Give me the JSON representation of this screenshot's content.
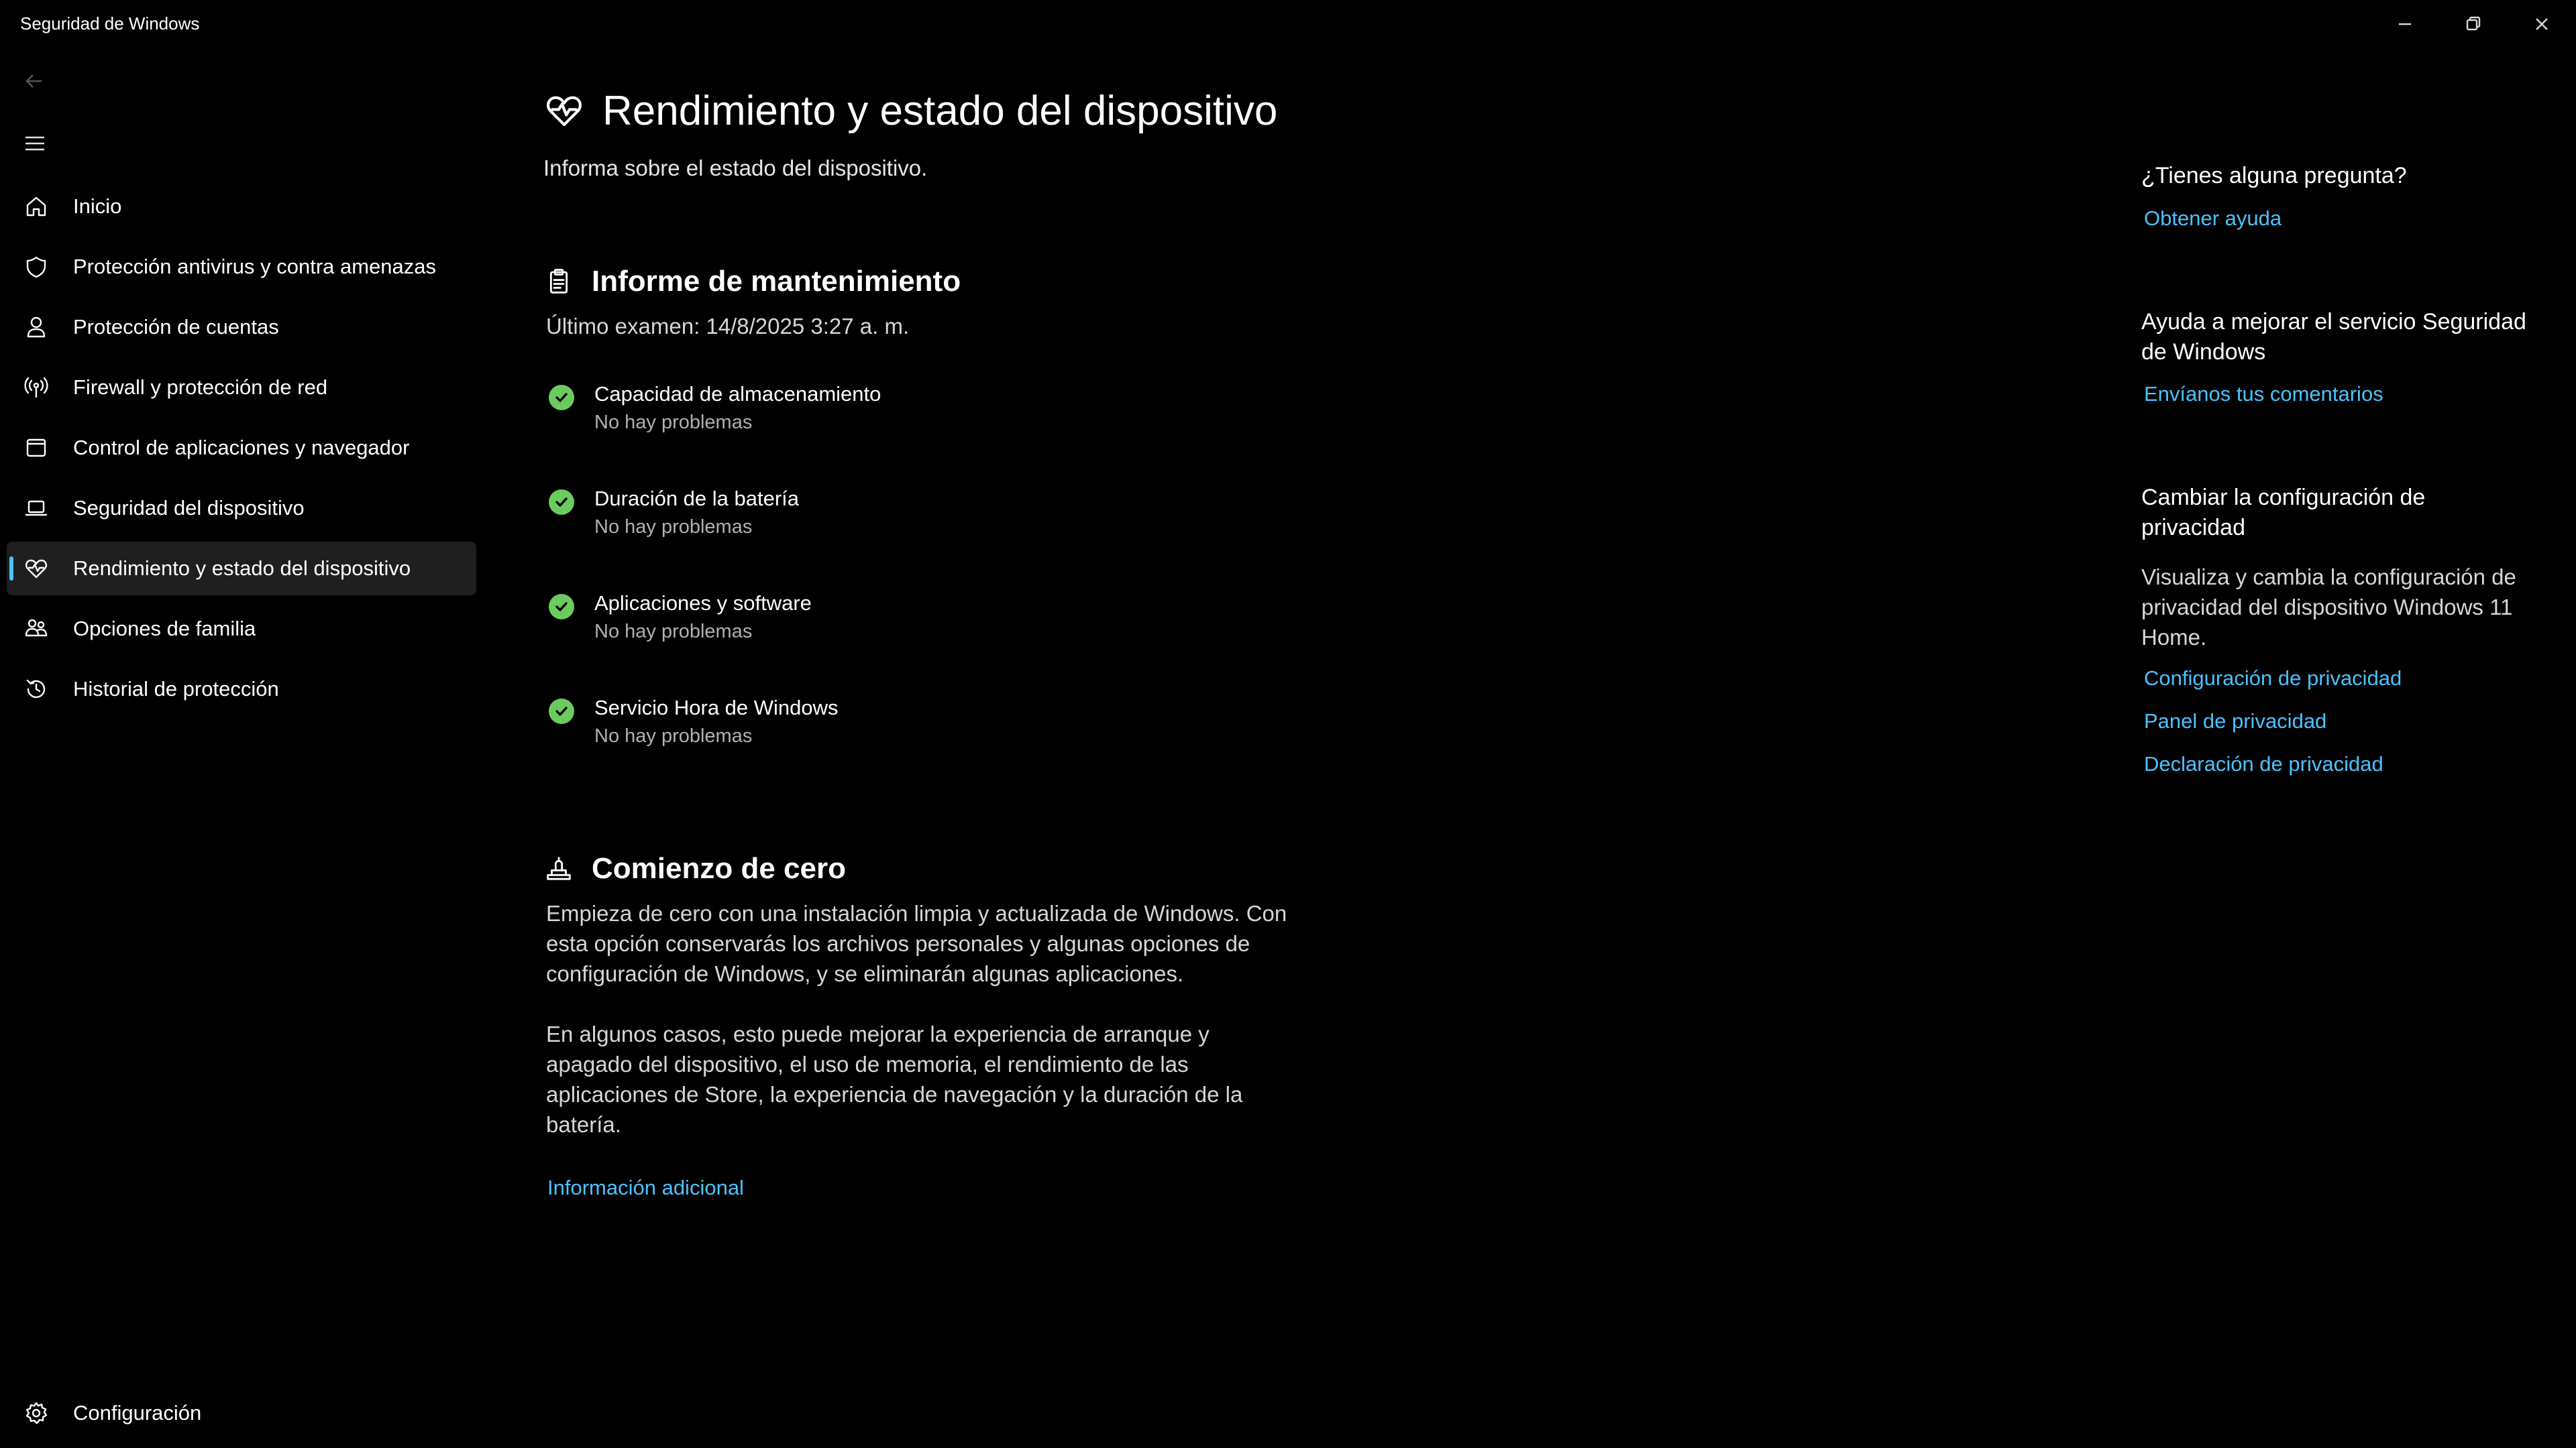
{
  "window": {
    "title": "Seguridad de Windows"
  },
  "nav": {
    "items": [
      {
        "label": "Inicio",
        "icon": "home-icon"
      },
      {
        "label": "Protección antivirus y contra amenazas",
        "icon": "shield-icon"
      },
      {
        "label": "Protección de cuentas",
        "icon": "person-icon"
      },
      {
        "label": "Firewall y protección de red",
        "icon": "antenna-icon"
      },
      {
        "label": "Control de aplicaciones y navegador",
        "icon": "app-window-icon"
      },
      {
        "label": "Seguridad del dispositivo",
        "icon": "laptop-icon"
      },
      {
        "label": "Rendimiento y estado del dispositivo",
        "icon": "heart-pulse-icon",
        "active": true
      },
      {
        "label": "Opciones de familia",
        "icon": "family-icon"
      },
      {
        "label": "Historial de protección",
        "icon": "history-icon"
      }
    ],
    "settings_label": "Configuración"
  },
  "main": {
    "title": "Rendimiento y estado del dispositivo",
    "subtitle": "Informa sobre el estado del dispositivo.",
    "maintenance": {
      "title": "Informe de mantenimiento",
      "last_scan": "Último examen: 14/8/2025 3:27 a. m.",
      "items": [
        {
          "title": "Capacidad de almacenamiento",
          "status": "No hay problemas"
        },
        {
          "title": "Duración de la batería",
          "status": "No hay problemas"
        },
        {
          "title": "Aplicaciones y software",
          "status": "No hay problemas"
        },
        {
          "title": "Servicio Hora de Windows",
          "status": "No hay problemas"
        }
      ]
    },
    "fresh_start": {
      "title": "Comienzo de cero",
      "paragraph1": "Empieza de cero con una instalación limpia y actualizada de Windows. Con esta opción conservarás los archivos personales y algunas opciones de configuración de Windows, y se eliminarán algunas aplicaciones.",
      "paragraph2": "En algunos casos, esto puede mejorar la experiencia de arranque y apagado del dispositivo, el uso de memoria, el rendimiento de las aplicaciones de Store, la experiencia de navegación y la duración de la batería.",
      "more_info_link": "Información adicional"
    }
  },
  "sidebar_right": {
    "question": {
      "heading": "¿Tienes alguna pregunta?",
      "link": "Obtener ayuda"
    },
    "improve": {
      "heading": "Ayuda a mejorar el servicio Seguridad de Windows",
      "link": "Envíanos tus comentarios"
    },
    "privacy": {
      "heading": "Cambiar la configuración de privacidad",
      "text": "Visualiza y cambia la configuración de privacidad del dispositivo Windows 11 Home.",
      "link1": "Configuración de privacidad",
      "link2": "Panel de privacidad",
      "link3": "Declaración de privacidad"
    }
  },
  "colors": {
    "background": "#000000",
    "accent": "#4cc2ff",
    "success": "#6ccb5f",
    "active_bg": "#1f1f1f"
  }
}
